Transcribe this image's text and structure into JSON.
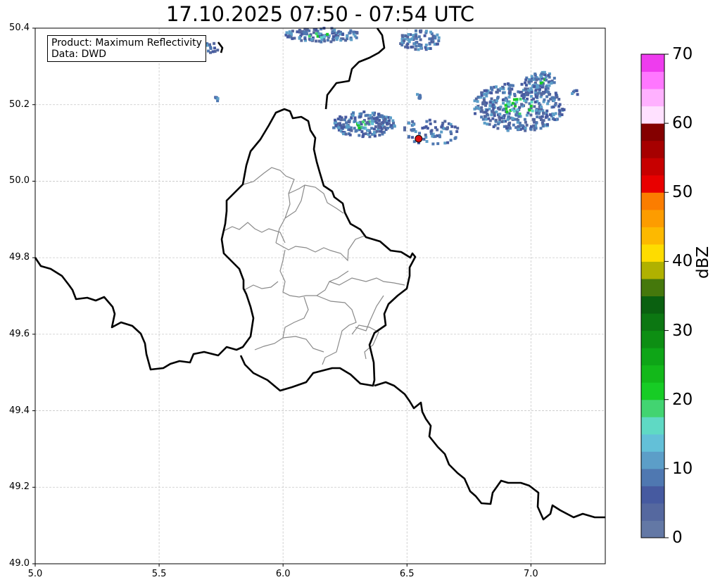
{
  "title": "17.10.2025 07:50 - 07:54 UTC",
  "info": {
    "product": "Product: Maximum Reflectivity",
    "source": "Data: DWD"
  },
  "axes": {
    "lon_range": [
      5.0,
      7.3
    ],
    "lat_range": [
      49.0,
      50.4
    ],
    "x_ticks": [
      "5.0",
      "5.5",
      "6.0",
      "6.5",
      "7.0"
    ],
    "y_ticks": [
      "50.4",
      "50.2",
      "50.0",
      "49.8",
      "49.6",
      "49.4",
      "49.2",
      "49.0"
    ],
    "grid": true
  },
  "colorbar": {
    "label": "dBZ",
    "ticks": [
      "70",
      "60",
      "50",
      "40",
      "30",
      "20",
      "10",
      "0"
    ],
    "range": [
      0,
      70
    ],
    "colors": [
      "#6378a5",
      "#55689f",
      "#465aa0",
      "#4f78b1",
      "#5c9ec8",
      "#63c0d8",
      "#5fd9c4",
      "#42d471",
      "#17cc25",
      "#13b81a",
      "#0ea517",
      "#0d8e13",
      "#0c7712",
      "#0a6010",
      "#45780c",
      "#b0b100",
      "#fedc00",
      "#fdb900",
      "#fd9c00",
      "#fb7d00",
      "#e80000",
      "#c70000",
      "#a60000",
      "#840000",
      "#ffe1ff",
      "#ffb1ff",
      "#ff77ff",
      "#ee3cee"
    ]
  },
  "marker": {
    "lon": 6.547,
    "lat": 50.111,
    "color": "#dd1111"
  },
  "colors": {
    "border": "#000000",
    "districts": "#8a8a8a",
    "grid": "#c8c8c8"
  }
}
